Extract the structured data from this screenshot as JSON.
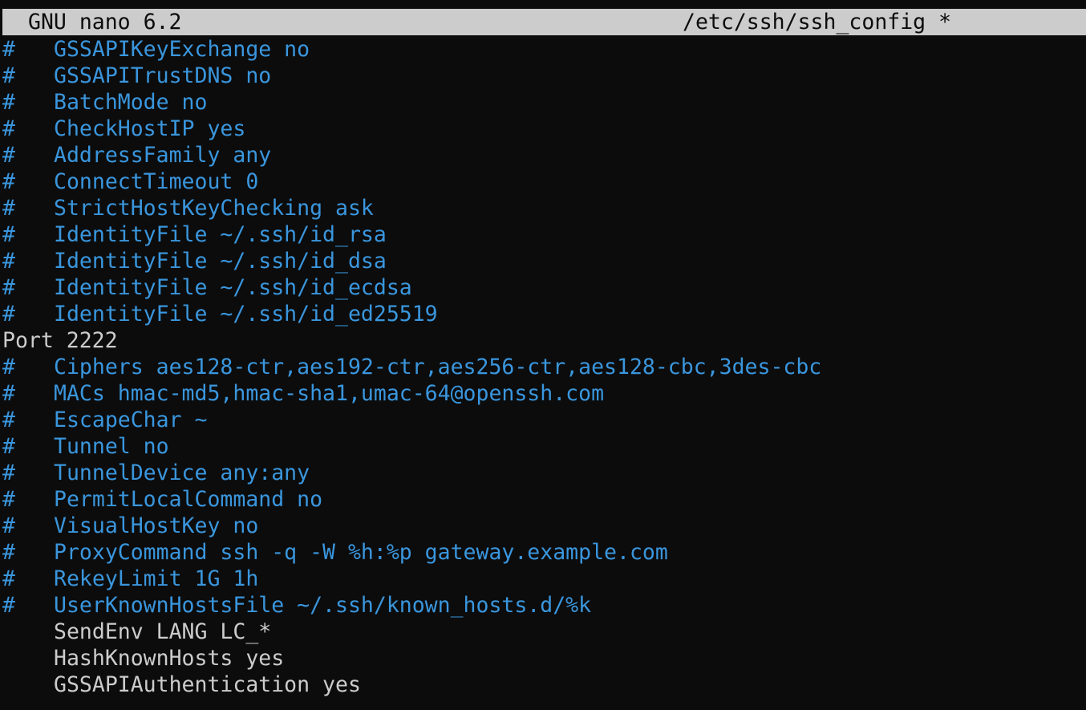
{
  "titlebar": {
    "app_name": "GNU nano 6.2",
    "file_path": "/etc/ssh/ssh_config *"
  },
  "colors": {
    "background": "#0c0c0c",
    "titlebar_bg": "#cccccc",
    "comment": "#3a96dd",
    "text": "#cccccc"
  },
  "lines": [
    {
      "hash": "#",
      "text": "GSSAPIKeyExchange no"
    },
    {
      "hash": "#",
      "text": "GSSAPITrustDNS no"
    },
    {
      "hash": "#",
      "text": "BatchMode no"
    },
    {
      "hash": "#",
      "text": "CheckHostIP yes"
    },
    {
      "hash": "#",
      "text": "AddressFamily any"
    },
    {
      "hash": "#",
      "text": "ConnectTimeout 0"
    },
    {
      "hash": "#",
      "text": "StrictHostKeyChecking ask"
    },
    {
      "hash": "#",
      "text": "IdentityFile ~/.ssh/id_rsa"
    },
    {
      "hash": "#",
      "text": "IdentityFile ~/.ssh/id_dsa"
    },
    {
      "hash": "#",
      "text": "IdentityFile ~/.ssh/id_ecdsa"
    },
    {
      "hash": "#",
      "text": "IdentityFile ~/.ssh/id_ed25519"
    },
    {
      "hash": "",
      "text": "Port 2222"
    },
    {
      "hash": "#",
      "text": "Ciphers aes128-ctr,aes192-ctr,aes256-ctr,aes128-cbc,3des-cbc"
    },
    {
      "hash": "#",
      "text": "MACs hmac-md5,hmac-sha1,umac-64@openssh.com"
    },
    {
      "hash": "#",
      "text": "EscapeChar ~"
    },
    {
      "hash": "#",
      "text": "Tunnel no"
    },
    {
      "hash": "#",
      "text": "TunnelDevice any:any"
    },
    {
      "hash": "#",
      "text": "PermitLocalCommand no"
    },
    {
      "hash": "#",
      "text": "VisualHostKey no"
    },
    {
      "hash": "#",
      "text": "ProxyCommand ssh -q -W %h:%p gateway.example.com"
    },
    {
      "hash": "#",
      "text": "RekeyLimit 1G 1h"
    },
    {
      "hash": "#",
      "text": "UserKnownHostsFile ~/.ssh/known_hosts.d/%k"
    },
    {
      "hash": "",
      "text": "SendEnv LANG LC_*"
    },
    {
      "hash": "",
      "text": "HashKnownHosts yes"
    },
    {
      "hash": "",
      "text": "GSSAPIAuthentication yes"
    }
  ]
}
